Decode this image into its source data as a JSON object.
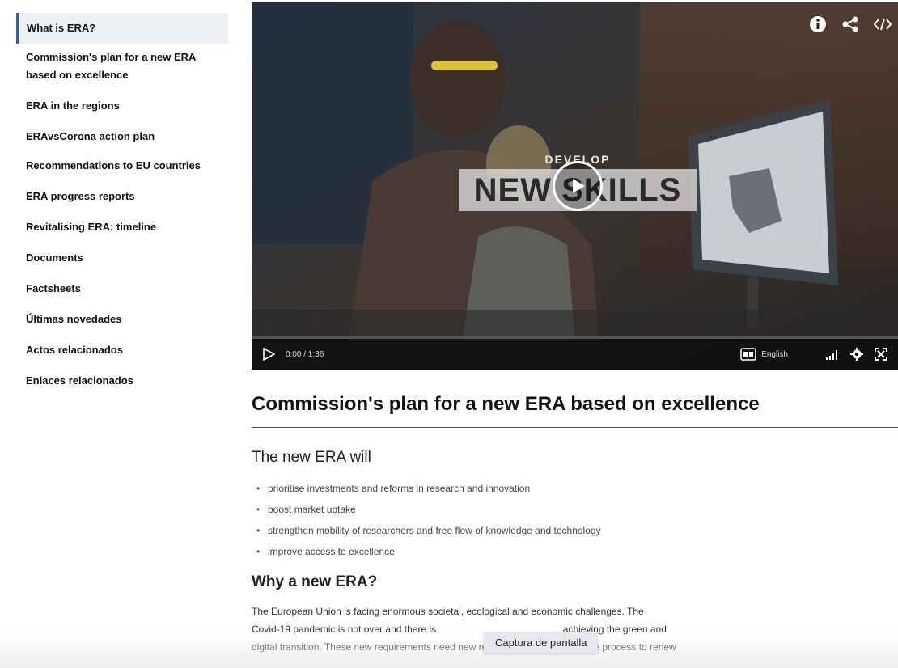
{
  "sidebar": {
    "items": [
      {
        "label": "What is ERA?",
        "active": true
      },
      {
        "label": "Commission's plan for a new ERA based on excellence"
      },
      {
        "label": "ERA in the regions"
      },
      {
        "label": "ERAvsCorona action plan"
      },
      {
        "label": "Recommendations to EU countries"
      },
      {
        "label": "ERA progress reports"
      },
      {
        "label": "Revitalising ERA: timeline"
      },
      {
        "label": "Documents"
      },
      {
        "label": "Factsheets"
      },
      {
        "label": "Últimas novedades"
      },
      {
        "label": "Actos relacionados"
      },
      {
        "label": "Enlaces relacionados"
      }
    ]
  },
  "video": {
    "overlay_small": "DEVELOP",
    "overlay_big": "NEW SKILLS",
    "time": "0:00 / 1:36",
    "language": "English",
    "progress": 0,
    "icons": [
      "info-icon",
      "share-icon",
      "embed-code-icon",
      "play-icon",
      "subtitles-icon",
      "volume-icon",
      "settings-icon",
      "fullscreen-icon"
    ]
  },
  "main": {
    "title": "Commission's plan for a new ERA based on excellence",
    "subtitle": "The new ERA will",
    "bullets": [
      "prioritise investments and reforms in research and innovation",
      "boost market uptake",
      "strengthen mobility of researchers and free flow of knowledge and technology",
      "improve access to excellence"
    ],
    "why_heading": "Why a new ERA?",
    "para_line1": "The European Union is facing enormous societal, ecological and economic challenges. The",
    "para_line2": "Covid-19 pandemic is not over and there is",
    "para_line2_end": ", achieving the green and",
    "para_line3": "digital transition. These new requirements need new responses, which is why the process to renew"
  },
  "tooltip": "Captura de pantalla",
  "colors": {
    "active_border": "#2b5f9e",
    "active_bg": "#eef1f4",
    "controls_bg": "#0f0f12"
  }
}
